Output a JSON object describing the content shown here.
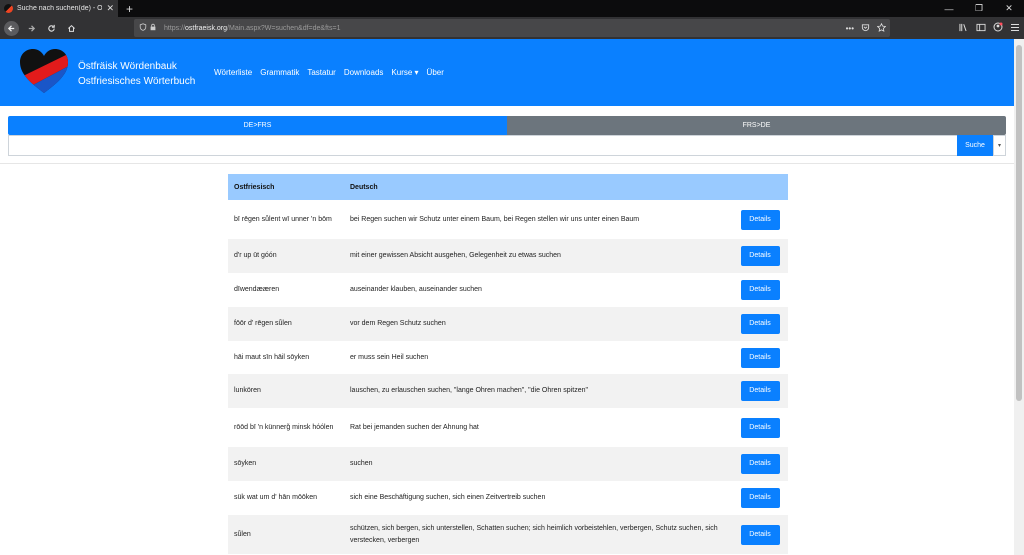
{
  "browser": {
    "tab_title": "Suche nach suchen(de) - Östfräi",
    "tab_close": "✕",
    "new_tab": "+",
    "url_scheme": "https://",
    "url_host": "ostfraeisk.org",
    "url_path": "/Main.aspx?W=suchen&df=de&fts=1",
    "url_more": "•••",
    "window_controls": [
      "—",
      "❐",
      "✕"
    ]
  },
  "header": {
    "brand_line1": "Östfräisk Wördenbauk",
    "brand_line2": "Ostfriesisches Wörterbuch",
    "menu": [
      "Wörterliste",
      "Grammatik",
      "Tastatur",
      "Downloads",
      "Kurse ▾",
      "Über"
    ],
    "colors": {
      "primary": "#0a80ff",
      "secondary": "#6c757d",
      "table_head": "#99caff"
    }
  },
  "direction": {
    "de_frs": "DE>FRS",
    "frs_de": "FRS>DE"
  },
  "search": {
    "value": "",
    "placeholder": "",
    "button": "Suche",
    "dropdown": "▾"
  },
  "table": {
    "headers": {
      "ost": "Ostfriesisch",
      "de": "Deutsch"
    },
    "details_label": "Details",
    "rows": [
      {
        "ost": "bī rēgen sǖlent wī unner 'n bōm",
        "de": "bei Regen suchen wir Schutz unter einem Baum, bei Regen stellen wir uns unter einen Baum"
      },
      {
        "ost": "d'r up ūt góón",
        "de": "mit einer gewissen Absicht ausgehen, Gelegenheit zu etwas suchen"
      },
      {
        "ost": "dīwendææren",
        "de": "auseinander klauben, auseinander suchen"
      },
      {
        "ost": "fōōr d' rēgen sǖlen",
        "de": "vor dem Regen Schutz suchen"
      },
      {
        "ost": "hāi maut sīn hāil sōyken",
        "de": "er muss sein Heil suchen"
      },
      {
        "ost": "lunkören",
        "de": "lauschen, zu erlauschen suchen, \"lange Ohren machen\", \"die Ohren spitzen\""
      },
      {
        "ost": "rōōd bī 'n künnerǧ minsk hóólen",
        "de": "Rat bei jemanden suchen der Ahnung hat"
      },
      {
        "ost": "sōyken",
        "de": "suchen"
      },
      {
        "ost": "sük wat um d' hān mōōken",
        "de": "sich eine Beschäftigung suchen, sich einen Zeitvertreib suchen"
      },
      {
        "ost": "sǖlen",
        "de": "schützen, sich bergen, sich unterstellen, Schatten suchen; sich heimlich vorbeistehlen, verbergen, Schutz suchen, sich verstecken, verbergen"
      }
    ]
  }
}
